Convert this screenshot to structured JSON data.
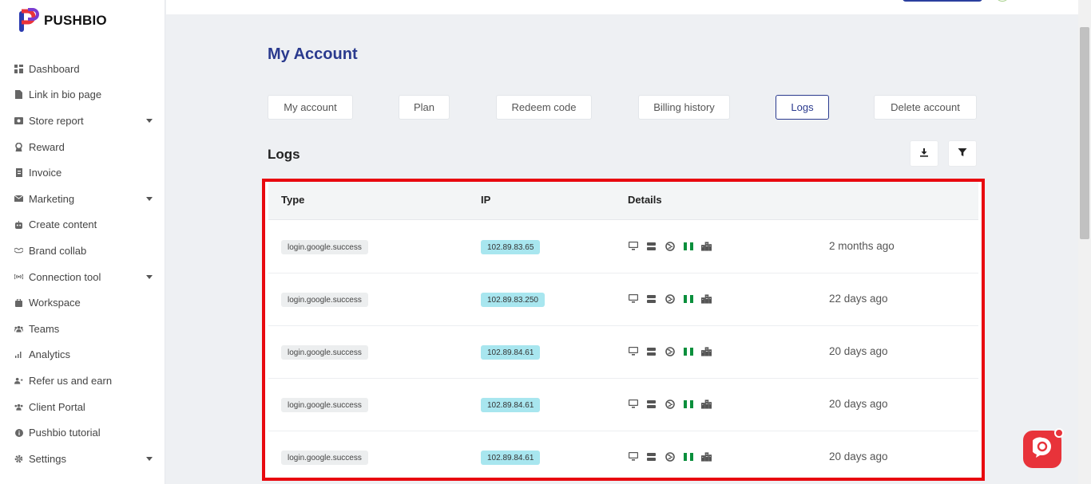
{
  "brand": {
    "name": "PUSHBIO"
  },
  "sidebar": {
    "items": [
      {
        "label": "Dashboard",
        "icon": "dashboard-icon",
        "has_caret": false
      },
      {
        "label": "Link in bio page",
        "icon": "page-icon",
        "has_caret": false
      },
      {
        "label": "Store report",
        "icon": "store-icon",
        "has_caret": true
      },
      {
        "label": "Reward",
        "icon": "reward-icon",
        "has_caret": false
      },
      {
        "label": "Invoice",
        "icon": "invoice-icon",
        "has_caret": false
      },
      {
        "label": "Marketing",
        "icon": "mail-icon",
        "has_caret": true
      },
      {
        "label": "Create content",
        "icon": "robot-icon",
        "has_caret": false
      },
      {
        "label": "Brand collab",
        "icon": "handshake-icon",
        "has_caret": false
      },
      {
        "label": "Connection tool",
        "icon": "connection-icon",
        "has_caret": true
      },
      {
        "label": "Workspace",
        "icon": "briefcase-icon",
        "has_caret": false
      },
      {
        "label": "Teams",
        "icon": "users-icon",
        "has_caret": false
      },
      {
        "label": "Analytics",
        "icon": "bar-chart-icon",
        "has_caret": false
      },
      {
        "label": "Refer us and earn",
        "icon": "user-plus-icon",
        "has_caret": false
      },
      {
        "label": "Client Portal",
        "icon": "users-icon",
        "has_caret": false
      },
      {
        "label": "Pushbio tutorial",
        "icon": "info-icon",
        "has_caret": false
      },
      {
        "label": "Settings",
        "icon": "gear-icon",
        "has_caret": true
      }
    ]
  },
  "main": {
    "title": "My Account",
    "tabs": [
      {
        "label": "My account",
        "active": false
      },
      {
        "label": "Plan",
        "active": false
      },
      {
        "label": "Redeem code",
        "active": false
      },
      {
        "label": "Billing history",
        "active": false
      },
      {
        "label": "Logs",
        "active": true
      },
      {
        "label": "Delete account",
        "active": false
      }
    ],
    "section_title": "Logs",
    "table": {
      "headers": {
        "type": "Type",
        "ip": "IP",
        "details": "Details"
      },
      "rows": [
        {
          "type": "login.google.success",
          "ip": "102.89.83.65",
          "when": "2 months ago"
        },
        {
          "type": "login.google.success",
          "ip": "102.89.83.250",
          "when": "22 days ago"
        },
        {
          "type": "login.google.success",
          "ip": "102.89.84.61",
          "when": "20 days ago"
        },
        {
          "type": "login.google.success",
          "ip": "102.89.84.61",
          "when": "20 days ago"
        },
        {
          "type": "login.google.success",
          "ip": "102.89.84.61",
          "when": "20 days ago"
        }
      ]
    }
  },
  "colors": {
    "accent": "#2a3a8e",
    "highlight_border": "#e8090f",
    "ip_badge": "#a8e6ef",
    "chat_widget": "#e8333a"
  }
}
